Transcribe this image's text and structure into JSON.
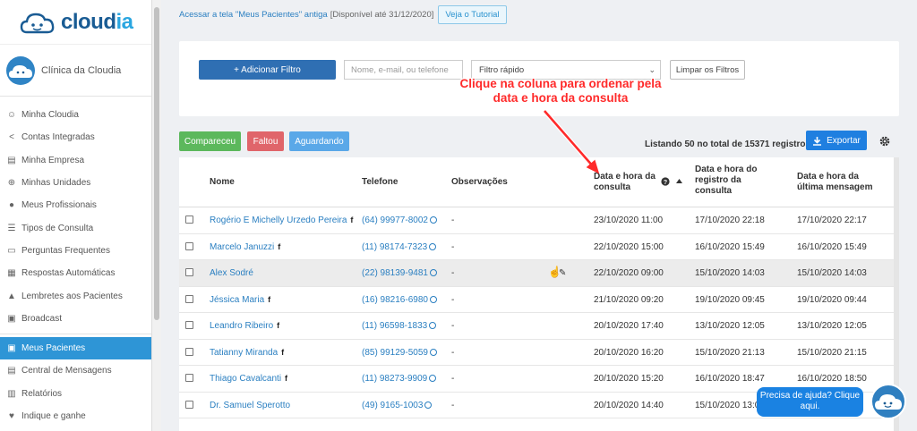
{
  "app": {
    "logo_prefix": "cloud",
    "logo_accent": "ia",
    "clinic_name": "Clínica da Cloudia"
  },
  "sidebar": {
    "items": [
      {
        "label": "Minha Cloudia",
        "icon": "face-icon"
      },
      {
        "label": "Contas Integradas",
        "icon": "share-icon"
      },
      {
        "label": "Minha Empresa",
        "icon": "store-icon"
      },
      {
        "label": "Minhas Unidades",
        "icon": "plus-circle-icon"
      },
      {
        "label": "Meus Profissionais",
        "icon": "people-icon"
      },
      {
        "label": "Tipos de Consulta",
        "icon": "list-icon"
      },
      {
        "label": "Perguntas Frequentes",
        "icon": "chat-icon"
      },
      {
        "label": "Respostas Automáticas",
        "icon": "message-icon"
      },
      {
        "label": "Lembretes aos Pacientes",
        "icon": "bell-icon"
      },
      {
        "label": "Broadcast",
        "icon": "broadcast-icon"
      },
      {
        "label": "Meus Pacientes",
        "icon": "contacts-icon",
        "active": true
      },
      {
        "label": "Central de Mensagens",
        "icon": "inbox-icon"
      },
      {
        "label": "Relatórios",
        "icon": "bar-chart-icon"
      },
      {
        "label": "Indique e ganhe",
        "icon": "heart-icon"
      }
    ]
  },
  "notice": {
    "link": "Acessar a tela \"Meus Pacientes\" antiga",
    "availability": "[Disponível até 31/12/2020]",
    "tutorial_button": "Veja o Tutorial"
  },
  "filters": {
    "add_filter": "+ Adicionar Filtro",
    "search_placeholder": "Nome, e-mail, ou telefone",
    "quick_filter": "Filtro rápido",
    "clear": "Limpar os Filtros"
  },
  "annotation": {
    "line1": "Clique na coluna para ordenar pela",
    "line2": "data e hora da consulta"
  },
  "status_buttons": {
    "compareceu": "Compareceu",
    "faltou": "Faltou",
    "aguardando": "Aguardando"
  },
  "listing": "Listando 50 no total de 15371 registros",
  "export": "Exportar",
  "colors": {
    "primary": "#2e95d6",
    "green": "#5cb85c",
    "red": "#e0656a",
    "annotation": "#ff2a2a"
  },
  "table": {
    "headers": {
      "name": "Nome",
      "phone": "Telefone",
      "notes": "Observações",
      "consult": [
        "Data e hora da",
        "consulta"
      ],
      "registered": [
        "Data e hora do",
        "registro da",
        "consulta"
      ],
      "last_message": [
        "Data e hora da",
        "última mensagem"
      ]
    },
    "rows": [
      {
        "name": "Rogério E Michelly Urzedo Pereira",
        "fb": true,
        "phone": "(64) 99977-8002",
        "notes": "-",
        "consult": "23/10/2020 11:00",
        "registered": "17/10/2020 22:18",
        "last_message": "17/10/2020 22:17"
      },
      {
        "name": "Marcelo Januzzi",
        "fb": true,
        "phone": "(11) 98174-7323",
        "notes": "-",
        "consult": "22/10/2020 15:00",
        "registered": "16/10/2020 15:49",
        "last_message": "16/10/2020 15:49"
      },
      {
        "name": "Alex Sodré",
        "fb": false,
        "phone": "(22) 98139-9481",
        "notes": "-",
        "consult": "22/10/2020 09:00",
        "registered": "15/10/2020 14:03",
        "last_message": "15/10/2020 14:03"
      },
      {
        "name": "Jéssica Maria",
        "fb": true,
        "phone": "(16) 98216-6980",
        "notes": "-",
        "consult": "21/10/2020 09:20",
        "registered": "19/10/2020 09:45",
        "last_message": "19/10/2020 09:44"
      },
      {
        "name": "Leandro Ribeiro",
        "fb": true,
        "phone": "(11) 96598-1833",
        "notes": "-",
        "consult": "20/10/2020 17:40",
        "registered": "13/10/2020 12:05",
        "last_message": "13/10/2020 12:05"
      },
      {
        "name": "Tatianny Miranda",
        "fb": true,
        "phone": "(85) 99129-5059",
        "notes": "-",
        "consult": "20/10/2020 16:20",
        "registered": "15/10/2020 21:13",
        "last_message": "15/10/2020 21:15"
      },
      {
        "name": "Thiago Cavalcanti",
        "fb": true,
        "phone": "(11) 98273-9909",
        "notes": "-",
        "consult": "20/10/2020 15:20",
        "registered": "16/10/2020 18:47",
        "last_message": "16/10/2020 18:50"
      },
      {
        "name": "Dr. Samuel Sperotto",
        "fb": false,
        "phone": "(49) 9165-1003",
        "notes": "-",
        "consult": "20/10/2020 14:40",
        "registered": "15/10/2020 13:0",
        "last_message": ""
      }
    ]
  },
  "help": {
    "text": "Precisa de ajuda? Clique aqui."
  }
}
